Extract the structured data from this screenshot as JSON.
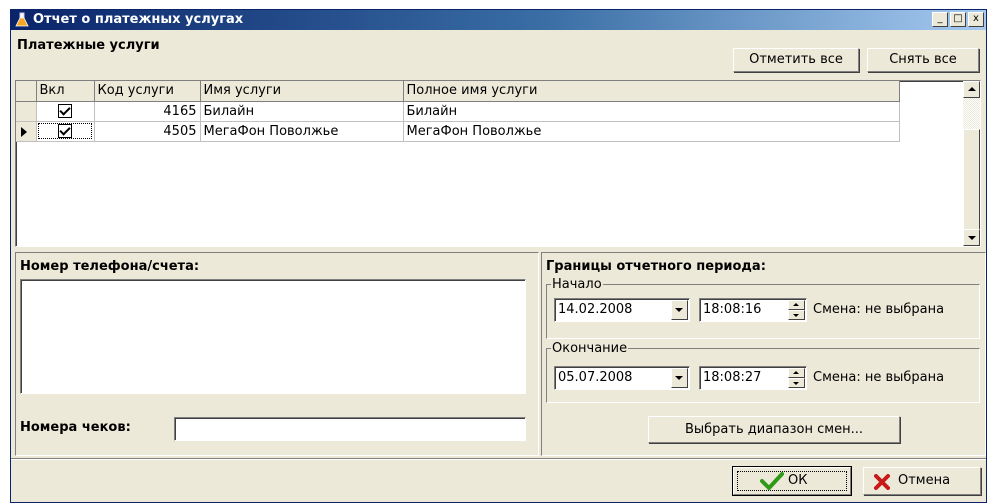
{
  "window": {
    "title": "Отчет о платежных услугах",
    "minimize": "_",
    "maximize": "□",
    "close": "x"
  },
  "services": {
    "heading": "Платежные услуги",
    "select_all_label": "Отметить все",
    "clear_all_label": "Снять все",
    "columns": [
      "Вкл",
      "Код услуги",
      "Имя услуги",
      "Полное имя услуги"
    ],
    "rows": [
      {
        "enabled": true,
        "code": "4165",
        "name": "Билайн",
        "full_name": "Билайн"
      },
      {
        "enabled": true,
        "code": "4505",
        "name": "МегаФон Поволжье",
        "full_name": "МегаФон Поволжье"
      }
    ]
  },
  "phone": {
    "label": "Номер телефона/счета:",
    "value": ""
  },
  "receipts": {
    "label": "Номера чеков:",
    "value": ""
  },
  "period": {
    "heading": "Границы отчетного периода:",
    "start": {
      "legend": "Начало",
      "date": "14.02.2008",
      "time": "18:08:16",
      "shift": "Смена: не выбрана"
    },
    "end": {
      "legend": "Окончание",
      "date": "05.07.2008",
      "time": "18:08:27",
      "shift": "Смена: не выбрана"
    },
    "range_button_label": "Выбрать диапазон смен..."
  },
  "footer": {
    "ok_label": "ОК",
    "cancel_label": "Отмена"
  },
  "colors": {
    "titlebar": "#0A246A",
    "face": "#ECE9D8",
    "ok_check": "#2E9A18",
    "cancel_x": "#C81818"
  }
}
